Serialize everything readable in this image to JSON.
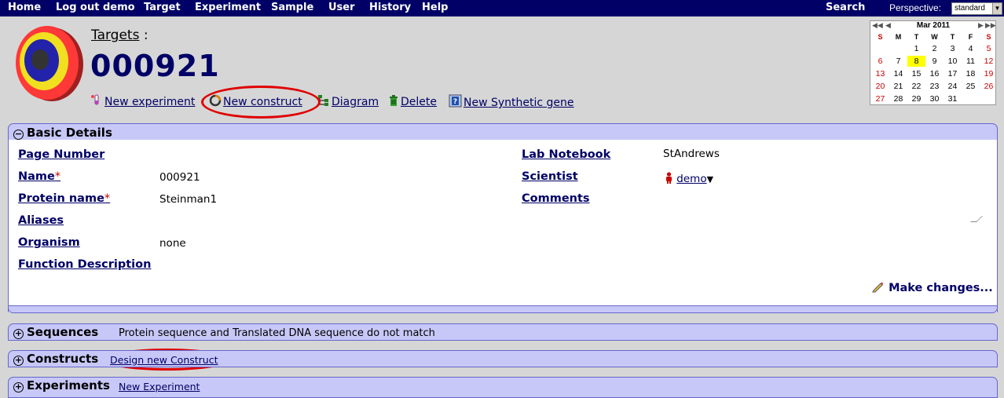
{
  "nav": {
    "items": [
      "Home",
      "Log out demo",
      "Target",
      "Experiment",
      "Sample",
      "User",
      "History",
      "Help"
    ],
    "search": "Search",
    "perspective_label": "Perspective:",
    "perspective_value": "standard"
  },
  "breadcrumb": {
    "link": "Targets",
    "sep": ":"
  },
  "title": "000921",
  "actions": {
    "new_experiment": "New experiment",
    "new_construct": "New construct",
    "diagram": "Diagram",
    "delete": "Delete",
    "new_synthetic_gene": "New Synthetic gene"
  },
  "calendar": {
    "month": "Mar 2011",
    "nav_prev_year": "◀◀",
    "nav_prev": "◀",
    "nav_next": "▶",
    "nav_next_year": "▶▶",
    "dow": [
      "S",
      "M",
      "T",
      "W",
      "T",
      "F",
      "S"
    ],
    "weeks": [
      [
        "",
        "",
        "1",
        "2",
        "3",
        "4",
        "5"
      ],
      [
        "6",
        "7",
        "8",
        "9",
        "10",
        "11",
        "12"
      ],
      [
        "13",
        "14",
        "15",
        "16",
        "17",
        "18",
        "19"
      ],
      [
        "20",
        "21",
        "22",
        "23",
        "24",
        "25",
        "26"
      ],
      [
        "27",
        "28",
        "29",
        "30",
        "31",
        "",
        ""
      ]
    ],
    "today": "8"
  },
  "basic_details": {
    "title": "Basic Details",
    "page_number_label": "Page Number",
    "page_number_value": "",
    "name_label": "Name",
    "name_value": "000921",
    "protein_name_label": "Protein name",
    "protein_name_value": "Steinman1",
    "aliases_label": "Aliases",
    "aliases_value": "",
    "organism_label": "Organism",
    "organism_value": "none",
    "function_description_label": "Function Description",
    "function_description_value": "",
    "lab_notebook_label": "Lab Notebook",
    "lab_notebook_value": "StAndrews",
    "scientist_label": "Scientist",
    "scientist_value": "demo",
    "comments_label": "Comments",
    "comments_value": "",
    "required_mark": "*",
    "make_changes": "Make changes..."
  },
  "sequences": {
    "title": "Sequences",
    "note": "Protein sequence and Translated DNA sequence do not match"
  },
  "constructs": {
    "title": "Constructs",
    "link": "Design new Construct"
  },
  "experiments": {
    "title": "Experiments",
    "link": "New Experiment"
  }
}
